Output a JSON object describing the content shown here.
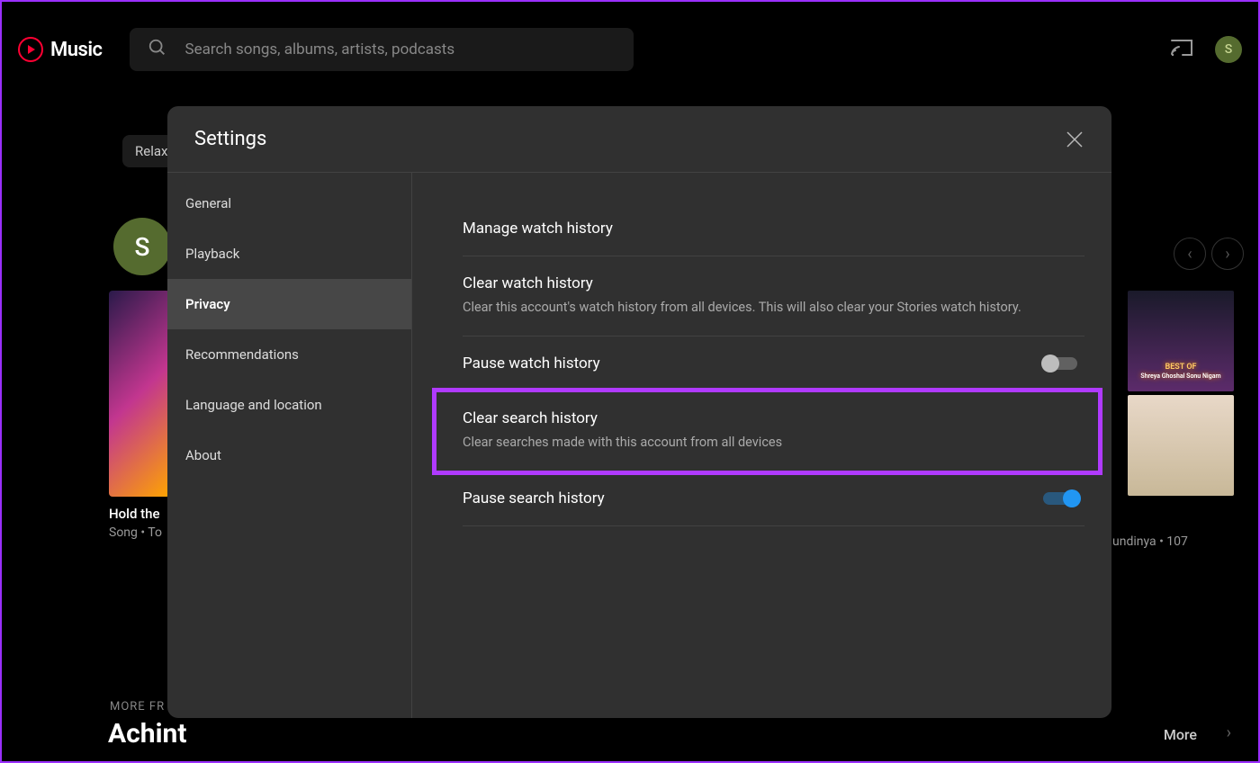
{
  "header": {
    "brand": "Music",
    "search_placeholder": "Search songs, albums, artists, podcasts",
    "avatar_letter": "S"
  },
  "background": {
    "chip": "Relax",
    "avatar_letter": "S",
    "card_left_title": "Hold the",
    "card_left_sub": "Song • To",
    "right_album1_text1": "BEST OF",
    "right_album1_text2": "Shreya Ghoshal\nSonu Nigam",
    "right_sub": "undinya • 107",
    "more_from": "MORE FR",
    "artist": "Achint",
    "more": "More"
  },
  "modal": {
    "title": "Settings",
    "sidebar": {
      "items": [
        {
          "label": "General"
        },
        {
          "label": "Playback"
        },
        {
          "label": "Privacy"
        },
        {
          "label": "Recommendations"
        },
        {
          "label": "Language and location"
        },
        {
          "label": "About"
        }
      ],
      "active_index": 2
    },
    "rows": {
      "manage_watch": {
        "title": "Manage watch history"
      },
      "clear_watch": {
        "title": "Clear watch history",
        "desc": "Clear this account's watch history from all devices. This will also clear your Stories watch history."
      },
      "pause_watch": {
        "title": "Pause watch history",
        "on": false
      },
      "clear_search": {
        "title": "Clear search history",
        "desc": "Clear searches made with this account from all devices"
      },
      "pause_search": {
        "title": "Pause search history",
        "on": true
      }
    }
  }
}
